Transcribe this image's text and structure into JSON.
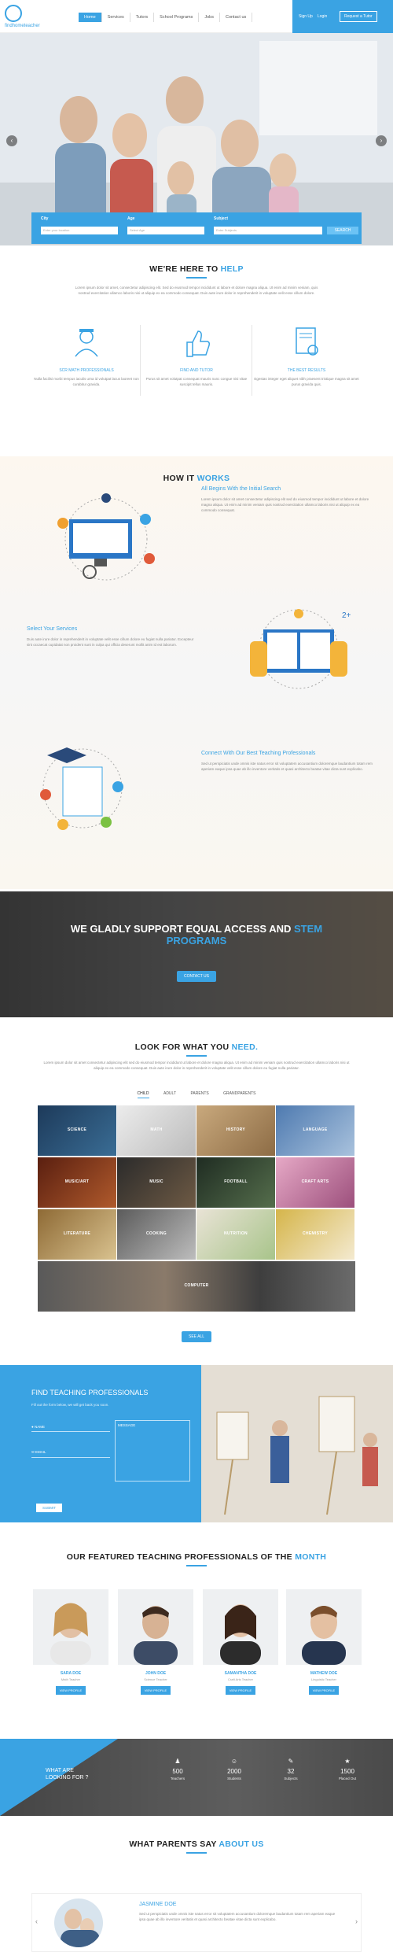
{
  "header": {
    "logo_text": "findhometeacher",
    "nav": [
      "Home",
      "Services",
      "Tutors",
      "School Programs",
      "Jobs",
      "Contact us"
    ],
    "sign_up": "Sign Up",
    "login": "Login",
    "cta": "Request a Tutor"
  },
  "search": {
    "city_label": "City",
    "city_placeholder": "Enter your location",
    "age_label": "Age",
    "age_placeholder": "Select Age",
    "subject_label": "Subject",
    "subject_placeholder": "Enter Subjects",
    "button": "SEARCH"
  },
  "help": {
    "title_a": "WE'RE HERE TO",
    "title_b": "HELP",
    "intro": "Lorem ipsum dolor sit amet, consectetur adipiscing elit. Sed do eiusmod tempor incididunt ut labore et dolore magna aliqua. Ut enim ad minim veniam, quis nostrud exercitation ullamco laboris nisi ut aliquip ex ea commodo consequat. Duis aute irure dolor in reprehenderit in voluptate velit esse cillum dolore.",
    "features": [
      {
        "title": "SCR MATH PROFESSIONALS",
        "text": "Nulla facilisi morbi tempus iaculis urna id volutpat lacus laoreet non curabitur gravida."
      },
      {
        "title": "FIND AND TUTOR",
        "text": "Purus sit amet volutpat consequat mauris nunc congue nisi vitae suscipit tellus mauris."
      },
      {
        "title": "THE BEST RESULTS",
        "text": "Egestas integer eget aliquet nibh praesent tristique magna sit amet purus gravida quis."
      }
    ]
  },
  "how": {
    "title_a": "HOW IT",
    "title_b": "WORKS",
    "steps": [
      {
        "title": "All Begins With the Initial Search",
        "text": "Lorem ipsum dolor sit amet consectetur adipiscing elit sed do eiusmod tempor incididunt ut labore et dolore magna aliqua. Ut enim ad minim veniam quis nostrud exercitation ullamco laboris nisi ut aliquip ex ea commodo consequat."
      },
      {
        "title": "Select Your Services",
        "text": "Duis aute irure dolor in reprehenderit in voluptate velit esse cillum dolore eu fugiat nulla pariatur. Excepteur sint occaecat cupidatat non proident sunt in culpa qui officia deserunt mollit anim id est laborum."
      },
      {
        "title": "Connect With Our Best Teaching Professionals",
        "text": "Sed ut perspiciatis unde omnis iste natus error sit voluptatem accusantium doloremque laudantium totam rem aperiam eaque ipsa quae ab illo inventore veritatis et quasi architecto beatae vitae dicta sunt explicabo."
      }
    ]
  },
  "stem": {
    "title_a": "WE GLADLY SUPPORT EQUAL ACCESS AND",
    "title_b": "STEM",
    "title_c": "PROGRAMS",
    "button": "CONTACT US"
  },
  "look": {
    "title_a": "LOOK FOR WHAT YOU",
    "title_b": "NEED.",
    "intro": "Lorem ipsum dolor sit amet consectetur adipiscing elit sed do eiusmod tempor incididunt ut labore et dolore magna aliqua. Ut enim ad minim veniam quis nostrud exercitation ullamco laboris nisi ut aliquip ex ea commodo consequat. Duis aute irure dolor in reprehenderit in voluptate velit esse cillum dolore eu fugiat nulla pariatur.",
    "tabs": [
      "CHILD",
      "ADULT",
      "PARENTS",
      "GRANDPARENTS"
    ],
    "tiles": [
      "SCIENCE",
      "MATH",
      "HISTORY",
      "LANGUAGE",
      "MUSIC/ART",
      "MUSIC",
      "FOOTBALL",
      "CRAFT ARTS",
      "LITERATURE",
      "COOKING",
      "NUTRITION",
      "CHEMISTRY",
      "COMPUTER",
      "",
      "",
      ""
    ],
    "button": "SEE ALL"
  },
  "find": {
    "title": "FIND TEACHING PROFESSIONALS",
    "subtitle": "Fill out the form below, we will get back you soon.",
    "name": "NAME",
    "email": "EMAIL",
    "message": "MESSAGE",
    "submit": "SUBMIT"
  },
  "featured": {
    "title_a": "OUR FEATURED TEACHING PROFESSIONALS OF THE",
    "title_b": "MONTH",
    "pros": [
      {
        "name": "SARA DOE",
        "role": "Math Teacher",
        "button": "VIEW PROFILE"
      },
      {
        "name": "JOHN DOE",
        "role": "Science Teacher",
        "button": "VIEW PROFILE"
      },
      {
        "name": "SAMANTHA DOE",
        "role": "Craft Arts Teacher",
        "button": "VIEW PROFILE"
      },
      {
        "name": "MATHEW DOE",
        "role": "Linguistic Teacher",
        "button": "VIEW PROFILE"
      }
    ]
  },
  "stats": {
    "looking_a": "WHAT ARE",
    "looking_b": "LOOKING FOR ?",
    "items": [
      {
        "num": "500",
        "label": "Teachers"
      },
      {
        "num": "2000",
        "label": "Students"
      },
      {
        "num": "32",
        "label": "Subjects"
      },
      {
        "num": "1500",
        "label": "Placed Out"
      }
    ]
  },
  "parents": {
    "title_a": "WHAT PARENTS SAY",
    "title_b": "ABOUT US",
    "name": "JASMINE DOE",
    "quote": "Sed ut perspiciatis unde omnis iste natus error sit voluptatem accusantium doloremque laudantium totam rem aperiam eaque ipsa quae ab illo inventore veritatis et quasi architecto beatae vitae dicta sunt explicabo."
  },
  "colors": {
    "accent": "#3aa3e3",
    "header_right": "#3aa3e3"
  }
}
